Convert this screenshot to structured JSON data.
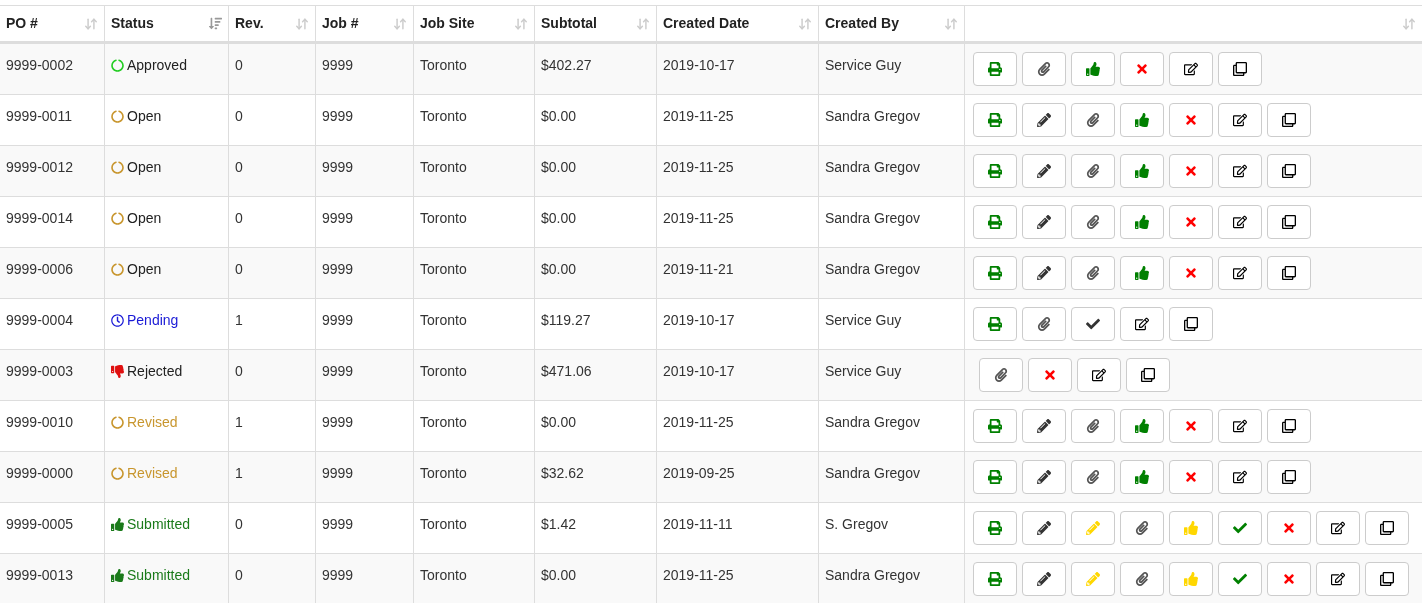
{
  "table": {
    "columns": [
      {
        "label": "PO #",
        "sorted": false
      },
      {
        "label": "Status",
        "sorted": true
      },
      {
        "label": "Rev.",
        "sorted": false
      },
      {
        "label": "Job #",
        "sorted": false
      },
      {
        "label": "Job Site",
        "sorted": false
      },
      {
        "label": "Subtotal",
        "sorted": false
      },
      {
        "label": "Created Date",
        "sorted": false
      },
      {
        "label": "Created By",
        "sorted": false
      },
      {
        "sorted": false
      }
    ],
    "rows": [
      {
        "po": "9999-0002",
        "status": {
          "label": "Approved",
          "kind": "approved"
        },
        "rev": "0",
        "job": "9999",
        "site": "Toronto",
        "subtotal": "$402.27",
        "date": "2019-10-17",
        "by": "Service Guy",
        "actions": [
          {
            "kind": "print",
            "color": "#008000"
          },
          {
            "kind": "attach",
            "color": "#555555"
          },
          {
            "kind": "thumbs-up",
            "color": "#008000"
          },
          {
            "kind": "reject",
            "color": "#ff0000"
          },
          {
            "kind": "note",
            "color": "#000000"
          },
          {
            "kind": "copy",
            "color": "#000000"
          }
        ]
      },
      {
        "po": "9999-0011",
        "status": {
          "label": "Open",
          "kind": "open"
        },
        "rev": "0",
        "job": "9999",
        "site": "Toronto",
        "subtotal": "$0.00",
        "date": "2019-11-25",
        "by": "Sandra Gregov",
        "actions": [
          {
            "kind": "print",
            "color": "#008000"
          },
          {
            "kind": "edit",
            "color": "#333333"
          },
          {
            "kind": "attach",
            "color": "#555555"
          },
          {
            "kind": "thumbs-up",
            "color": "#008000"
          },
          {
            "kind": "reject",
            "color": "#ff0000"
          },
          {
            "kind": "note",
            "color": "#000000"
          },
          {
            "kind": "copy",
            "color": "#000000"
          }
        ]
      },
      {
        "po": "9999-0012",
        "status": {
          "label": "Open",
          "kind": "open"
        },
        "rev": "0",
        "job": "9999",
        "site": "Toronto",
        "subtotal": "$0.00",
        "date": "2019-11-25",
        "by": "Sandra Gregov",
        "actions": [
          {
            "kind": "print",
            "color": "#008000"
          },
          {
            "kind": "edit",
            "color": "#333333"
          },
          {
            "kind": "attach",
            "color": "#555555"
          },
          {
            "kind": "thumbs-up",
            "color": "#008000"
          },
          {
            "kind": "reject",
            "color": "#ff0000"
          },
          {
            "kind": "note",
            "color": "#000000"
          },
          {
            "kind": "copy",
            "color": "#000000"
          }
        ]
      },
      {
        "po": "9999-0014",
        "status": {
          "label": "Open",
          "kind": "open"
        },
        "rev": "0",
        "job": "9999",
        "site": "Toronto",
        "subtotal": "$0.00",
        "date": "2019-11-25",
        "by": "Sandra Gregov",
        "actions": [
          {
            "kind": "print",
            "color": "#008000"
          },
          {
            "kind": "edit",
            "color": "#333333"
          },
          {
            "kind": "attach",
            "color": "#555555"
          },
          {
            "kind": "thumbs-up",
            "color": "#008000"
          },
          {
            "kind": "reject",
            "color": "#ff0000"
          },
          {
            "kind": "note",
            "color": "#000000"
          },
          {
            "kind": "copy",
            "color": "#000000"
          }
        ]
      },
      {
        "po": "9999-0006",
        "status": {
          "label": "Open",
          "kind": "open"
        },
        "rev": "0",
        "job": "9999",
        "site": "Toronto",
        "subtotal": "$0.00",
        "date": "2019-11-21",
        "by": "Sandra Gregov",
        "actions": [
          {
            "kind": "print",
            "color": "#008000"
          },
          {
            "kind": "edit",
            "color": "#333333"
          },
          {
            "kind": "attach",
            "color": "#555555"
          },
          {
            "kind": "thumbs-up",
            "color": "#008000"
          },
          {
            "kind": "reject",
            "color": "#ff0000"
          },
          {
            "kind": "note",
            "color": "#000000"
          },
          {
            "kind": "copy",
            "color": "#000000"
          }
        ]
      },
      {
        "po": "9999-0004",
        "status": {
          "label": "Pending",
          "kind": "pending"
        },
        "rev": "1",
        "job": "9999",
        "site": "Toronto",
        "subtotal": "$119.27",
        "date": "2019-10-17",
        "by": "Service Guy",
        "actions": [
          {
            "kind": "print",
            "color": "#008000"
          },
          {
            "kind": "attach",
            "color": "#555555"
          },
          {
            "kind": "check",
            "color": "#333333"
          },
          {
            "kind": "note",
            "color": "#000000"
          },
          {
            "kind": "copy",
            "color": "#000000"
          }
        ]
      },
      {
        "po": "9999-0003",
        "status": {
          "label": "Rejected",
          "kind": "rejected"
        },
        "rev": "0",
        "job": "9999",
        "site": "Toronto",
        "subtotal": "$471.06",
        "date": "2019-10-17",
        "by": "Service Guy",
        "actions": [
          {
            "kind": "attach",
            "color": "#555555"
          },
          {
            "kind": "reject",
            "color": "#ff0000"
          },
          {
            "kind": "note",
            "color": "#000000"
          },
          {
            "kind": "copy",
            "color": "#000000"
          }
        ]
      },
      {
        "po": "9999-0010",
        "status": {
          "label": "Revised",
          "kind": "revised"
        },
        "rev": "1",
        "job": "9999",
        "site": "Toronto",
        "subtotal": "$0.00",
        "date": "2019-11-25",
        "by": "Sandra Gregov",
        "actions": [
          {
            "kind": "print",
            "color": "#008000"
          },
          {
            "kind": "edit",
            "color": "#333333"
          },
          {
            "kind": "attach",
            "color": "#555555"
          },
          {
            "kind": "thumbs-up",
            "color": "#008000"
          },
          {
            "kind": "reject",
            "color": "#ff0000"
          },
          {
            "kind": "note",
            "color": "#000000"
          },
          {
            "kind": "copy",
            "color": "#000000"
          }
        ]
      },
      {
        "po": "9999-0000",
        "status": {
          "label": "Revised",
          "kind": "revised"
        },
        "rev": "1",
        "job": "9999",
        "site": "Toronto",
        "subtotal": "$32.62",
        "date": "2019-09-25",
        "by": "Sandra Gregov",
        "actions": [
          {
            "kind": "print",
            "color": "#008000"
          },
          {
            "kind": "edit",
            "color": "#333333"
          },
          {
            "kind": "attach",
            "color": "#555555"
          },
          {
            "kind": "thumbs-up",
            "color": "#008000"
          },
          {
            "kind": "reject",
            "color": "#ff0000"
          },
          {
            "kind": "note",
            "color": "#000000"
          },
          {
            "kind": "copy",
            "color": "#000000"
          }
        ]
      },
      {
        "po": "9999-0005",
        "status": {
          "label": "Submitted",
          "kind": "submitted"
        },
        "rev": "0",
        "job": "9999",
        "site": "Toronto",
        "subtotal": "$1.42",
        "date": "2019-11-11",
        "by": "S. Gregov",
        "actions": [
          {
            "kind": "print",
            "color": "#008000"
          },
          {
            "kind": "edit",
            "color": "#333333"
          },
          {
            "kind": "edit",
            "color": "#ffd700"
          },
          {
            "kind": "attach",
            "color": "#555555"
          },
          {
            "kind": "thumbs-up",
            "color": "#ffd700"
          },
          {
            "kind": "check",
            "color": "#008000"
          },
          {
            "kind": "reject",
            "color": "#ff0000"
          },
          {
            "kind": "note",
            "color": "#000000"
          },
          {
            "kind": "copy",
            "color": "#000000"
          }
        ]
      },
      {
        "po": "9999-0013",
        "status": {
          "label": "Submitted",
          "kind": "submitted"
        },
        "rev": "0",
        "job": "9999",
        "site": "Toronto",
        "subtotal": "$0.00",
        "date": "2019-11-25",
        "by": "Sandra Gregov",
        "actions": [
          {
            "kind": "print",
            "color": "#008000"
          },
          {
            "kind": "edit",
            "color": "#333333"
          },
          {
            "kind": "edit",
            "color": "#ffd700"
          },
          {
            "kind": "attach",
            "color": "#555555"
          },
          {
            "kind": "thumbs-up",
            "color": "#ffd700"
          },
          {
            "kind": "check",
            "color": "#008000"
          },
          {
            "kind": "reject",
            "color": "#ff0000"
          },
          {
            "kind": "note",
            "color": "#000000"
          },
          {
            "kind": "copy",
            "color": "#000000"
          }
        ]
      }
    ]
  }
}
